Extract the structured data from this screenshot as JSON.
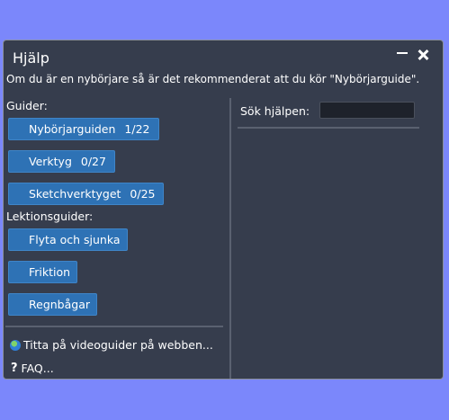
{
  "window": {
    "title": "Hjälp",
    "banner": "Om du är en nybörjare så är det rekommenderat att du kör \"Nybörjarguide\"."
  },
  "guides": {
    "heading": "Guider:",
    "items": [
      {
        "label": "Nybörjarguiden",
        "count": "1/22"
      },
      {
        "label": "Verktyg",
        "count": "0/27"
      },
      {
        "label": "Sketchverktyget",
        "count": "0/25"
      }
    ]
  },
  "lessons": {
    "heading": "Lektionsguider:",
    "items": [
      {
        "label": "Flyta och sjunka"
      },
      {
        "label": "Friktion"
      },
      {
        "label": "Regnbågar"
      }
    ]
  },
  "links": {
    "video": "Titta på videoguider på webben...",
    "faq": "FAQ..."
  },
  "search": {
    "label": "Sök hjälpen:",
    "value": ""
  },
  "colors": {
    "background": "#7b87fb",
    "window": "#363d4d",
    "button": "#2e72b5"
  }
}
